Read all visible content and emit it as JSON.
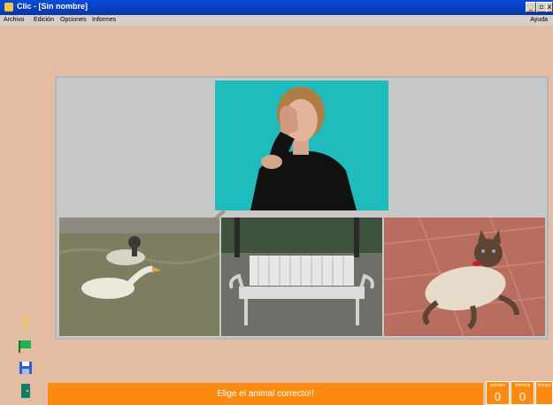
{
  "window": {
    "title": "Clic - [Sin nombre]"
  },
  "menu": {
    "items": [
      "Archivo",
      "Edición",
      "Opciones",
      "Informes"
    ],
    "help": "Ayuda"
  },
  "board": {
    "prompt_image": "woman-signing-video",
    "options": [
      "ducks-image",
      "bench-image",
      "cat-image"
    ]
  },
  "status": {
    "message": "Elige el animal correcto!!"
  },
  "counters": [
    {
      "label": "aciertos",
      "value": "0"
    },
    {
      "label": "intentos",
      "value": "0"
    },
    {
      "label": "tiempo",
      "value": ""
    }
  ],
  "colors": {
    "background": "#e3bca1",
    "status": "#fb8a10",
    "board": "#c8c8c8"
  }
}
